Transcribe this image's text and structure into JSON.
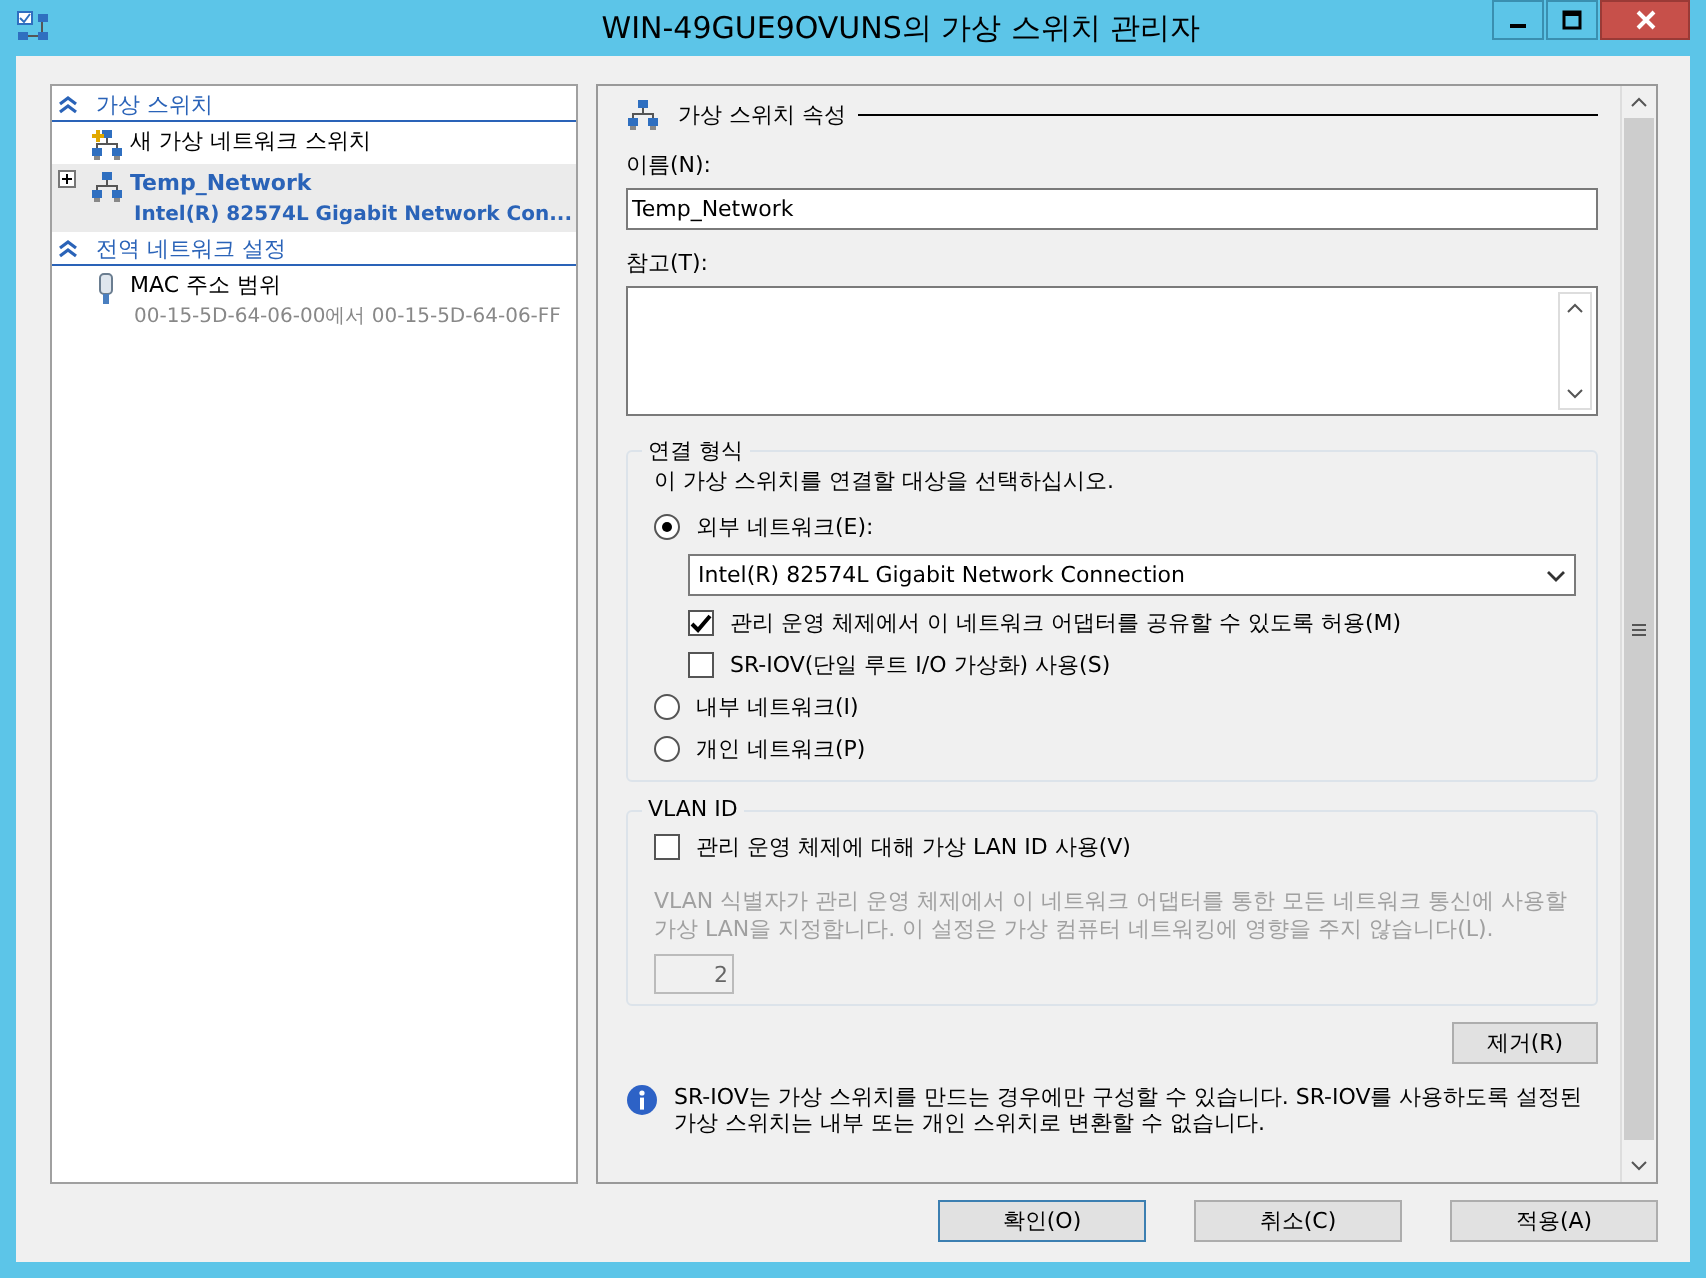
{
  "window": {
    "title": "WIN-49GUE9OVUNS의 가상 스위치 관리자"
  },
  "sidebar": {
    "sections": [
      {
        "title": "가상 스위치",
        "expanded": true,
        "items": [
          {
            "kind": "new-switch",
            "label": "새 가상 네트워크 스위치",
            "selected": false
          },
          {
            "kind": "switch",
            "label": "Temp_Network",
            "sublabel": "Intel(R) 82574L Gigabit Network Con...",
            "selected": true
          }
        ]
      },
      {
        "title": "전역 네트워크 설정",
        "expanded": true,
        "items": [
          {
            "kind": "mac",
            "label": "MAC 주소 범위",
            "sublabel": "00-15-5D-64-06-00에서 00-15-5D-64-06-FF",
            "selected": false
          }
        ]
      }
    ]
  },
  "properties": {
    "header": "가상 스위치 속성",
    "name_label": "이름(N):",
    "name_value": "Temp_Network",
    "notes_label": "참고(T):",
    "connection": {
      "title": "연결 형식",
      "prompt": "이 가상 스위치를 연결할 대상을 선택하십시오.",
      "types": [
        {
          "label": "외부 네트워크(E):",
          "selected": true,
          "adapter": "Intel(R) 82574L Gigabit Network Connection",
          "options": [
            {
              "label": "관리 운영 체제에서 이 네트워크 어댑터를 공유할 수 있도록 허용(M)",
              "checked": true
            },
            {
              "label": "SR-IOV(단일 루트 I/O 가상화) 사용(S)",
              "checked": false
            }
          ]
        },
        {
          "label": "내부 네트워크(I)",
          "selected": false
        },
        {
          "label": "개인 네트워크(P)",
          "selected": false
        }
      ]
    },
    "vlan": {
      "title": "VLAN ID",
      "checkbox": {
        "label": "관리 운영 체제에 대해 가상 LAN ID 사용(V)",
        "checked": false
      },
      "description": "VLAN 식별자가 관리 운영 체제에서 이 네트워크 어댑터를 통한 모든 네트워크 통신에 사용할 가상 LAN을 지정합니다. 이 설정은 가상 컴퓨터 네트워킹에 영향을 주지 않습니다(L).",
      "value": "2",
      "disabled": true
    },
    "remove_button": "제거(R)",
    "info": "SR-IOV는 가상 스위치를 만드는 경우에만 구성할 수 있습니다. SR-IOV를 사용하도록 설정된 가상 스위치는 내부 또는 개인 스위치로 변환할 수 없습니다."
  },
  "buttons": [
    {
      "label": "확인(O)",
      "default": true
    },
    {
      "label": "취소(C)",
      "default": false
    },
    {
      "label": "적용(A)",
      "default": false
    }
  ]
}
